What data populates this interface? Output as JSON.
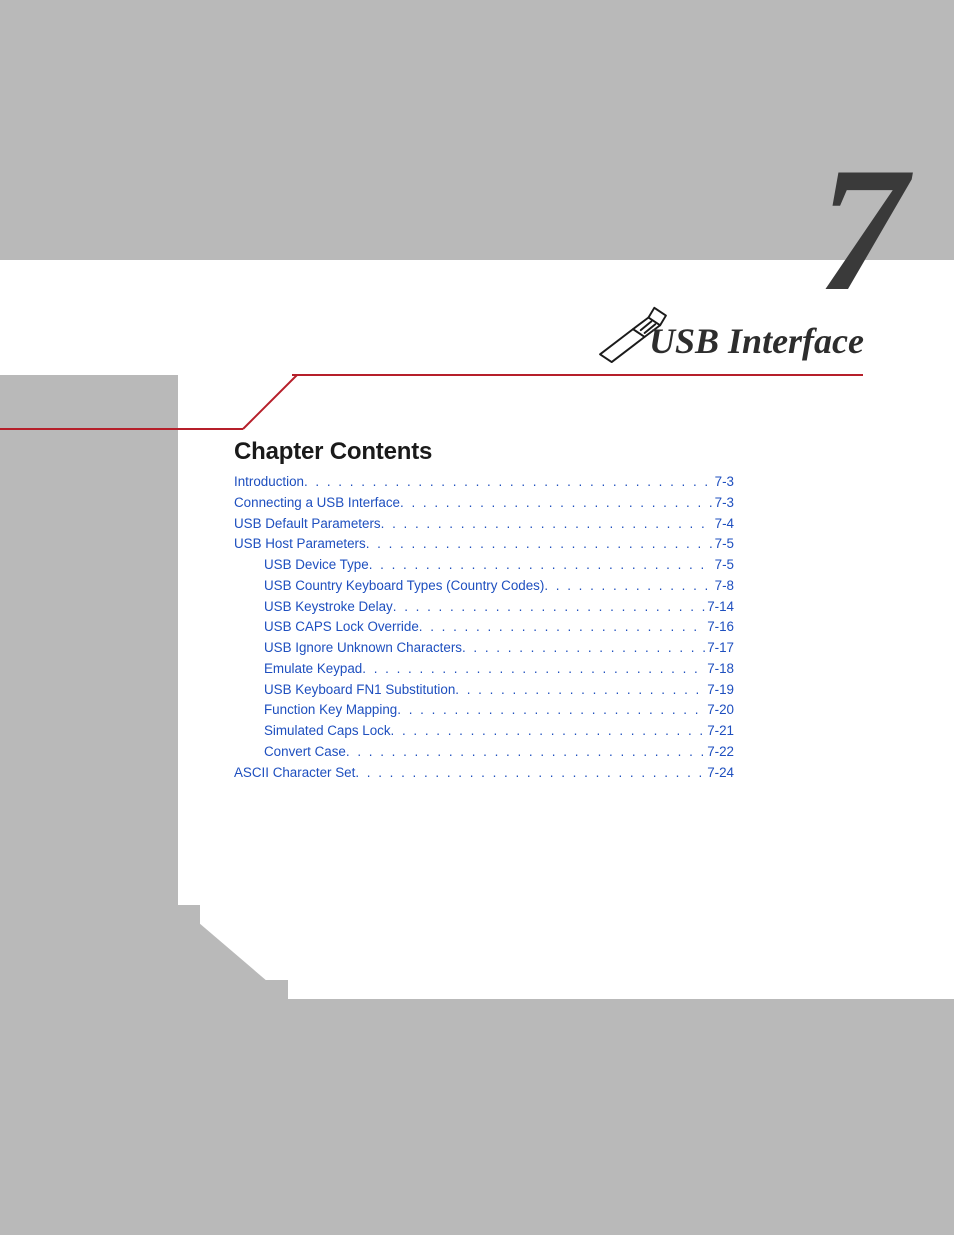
{
  "chapter": {
    "number": "7",
    "title": "USB Interface",
    "section_heading": "Chapter Contents"
  },
  "toc": [
    {
      "label": "Introduction",
      "page": "7-3",
      "level": 0
    },
    {
      "label": "Connecting a USB Interface",
      "page": "7-3",
      "level": 0
    },
    {
      "label": "USB Default Parameters",
      "page": "7-4",
      "level": 0
    },
    {
      "label": "USB Host Parameters",
      "page": "7-5",
      "level": 0
    },
    {
      "label": "USB Device Type",
      "page": "7-5",
      "level": 1
    },
    {
      "label": "USB Country Keyboard Types (Country Codes)",
      "page": "7-8",
      "level": 1
    },
    {
      "label": "USB Keystroke Delay",
      "page": "7-14",
      "level": 1
    },
    {
      "label": "USB CAPS Lock Override",
      "page": "7-16",
      "level": 1
    },
    {
      "label": "USB Ignore Unknown Characters",
      "page": "7-17",
      "level": 1
    },
    {
      "label": "Emulate Keypad",
      "page": "7-18",
      "level": 1
    },
    {
      "label": "USB Keyboard FN1 Substitution",
      "page": "7-19",
      "level": 1
    },
    {
      "label": "Function Key Mapping",
      "page": "7-20",
      "level": 1
    },
    {
      "label": "Simulated Caps Lock",
      "page": "7-21",
      "level": 1
    },
    {
      "label": "Convert Case",
      "page": "7-22",
      "level": 1
    },
    {
      "label": "ASCII Character Set",
      "page": "7-24",
      "level": 0
    }
  ]
}
